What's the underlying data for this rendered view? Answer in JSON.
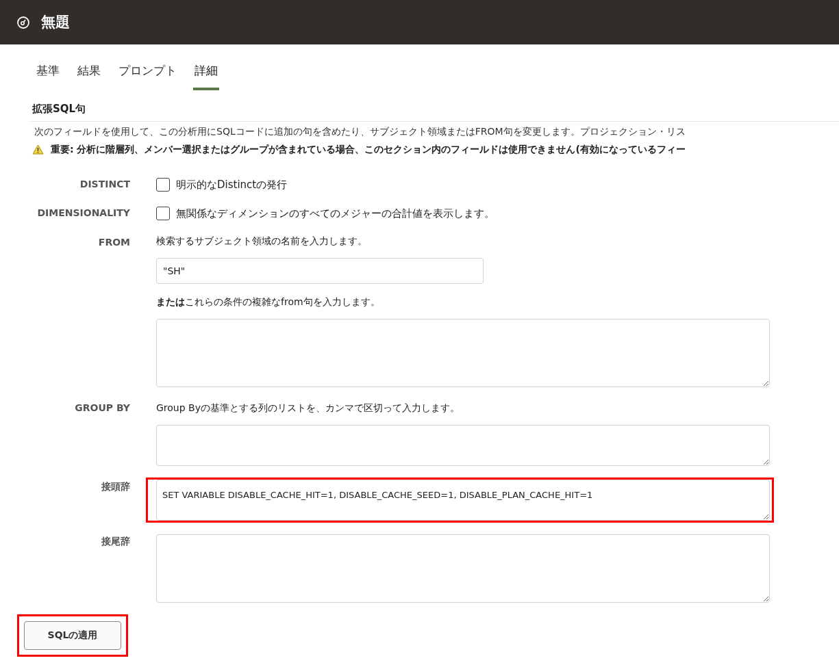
{
  "window": {
    "title": "無題"
  },
  "tabs": [
    {
      "label": "基準",
      "selected": false
    },
    {
      "label": "結果",
      "selected": false
    },
    {
      "label": "プロンプト",
      "selected": false
    },
    {
      "label": "詳細",
      "selected": true
    }
  ],
  "section": {
    "title": "拡張SQL句",
    "description": "次のフィールドを使用して、この分析用にSQLコードに追加の句を含めたり、サブジェクト領域またはFROM句を変更します。プロジェクション・リス",
    "warning": "重要: 分析に階層列、メンバー選択またはグループが含まれている場合、このセクション内のフィールドは使用できません(有効になっているフィー"
  },
  "rows": [
    {
      "label": "DISTINCT",
      "kind": "checkbox",
      "text": "明示的なDistinctの発行",
      "checked": false
    },
    {
      "label": "DIMENSIONALITY",
      "kind": "checkbox",
      "text": "無関係なディメンションのすべてのメジャーの合計値を表示します。",
      "checked": false
    },
    {
      "label": "FROM",
      "kind": "from",
      "hint": "検索するサブジェクト領域の名前を入力します。",
      "value": "\"SH\"",
      "hint2": "**または**これらの条件の複雑なfrom句を入力します。"
    },
    {
      "label": "GROUP BY",
      "kind": "shortarea",
      "hint": "Group Byの基準とする列のリストを、カンマで区切って入力します。"
    },
    {
      "label": "接頭辞",
      "kind": "shortarea",
      "value": "SET VARIABLE DISABLE_CACHE_HIT=1, DISABLE_CACHE_SEED=1, DISABLE_PLAN_CACHE_HIT=1",
      "highlighted": true
    },
    {
      "label": "接尾辞",
      "kind": "textarea"
    }
  ],
  "apply_button": {
    "label": "SQLの適用",
    "highlighted": true
  }
}
